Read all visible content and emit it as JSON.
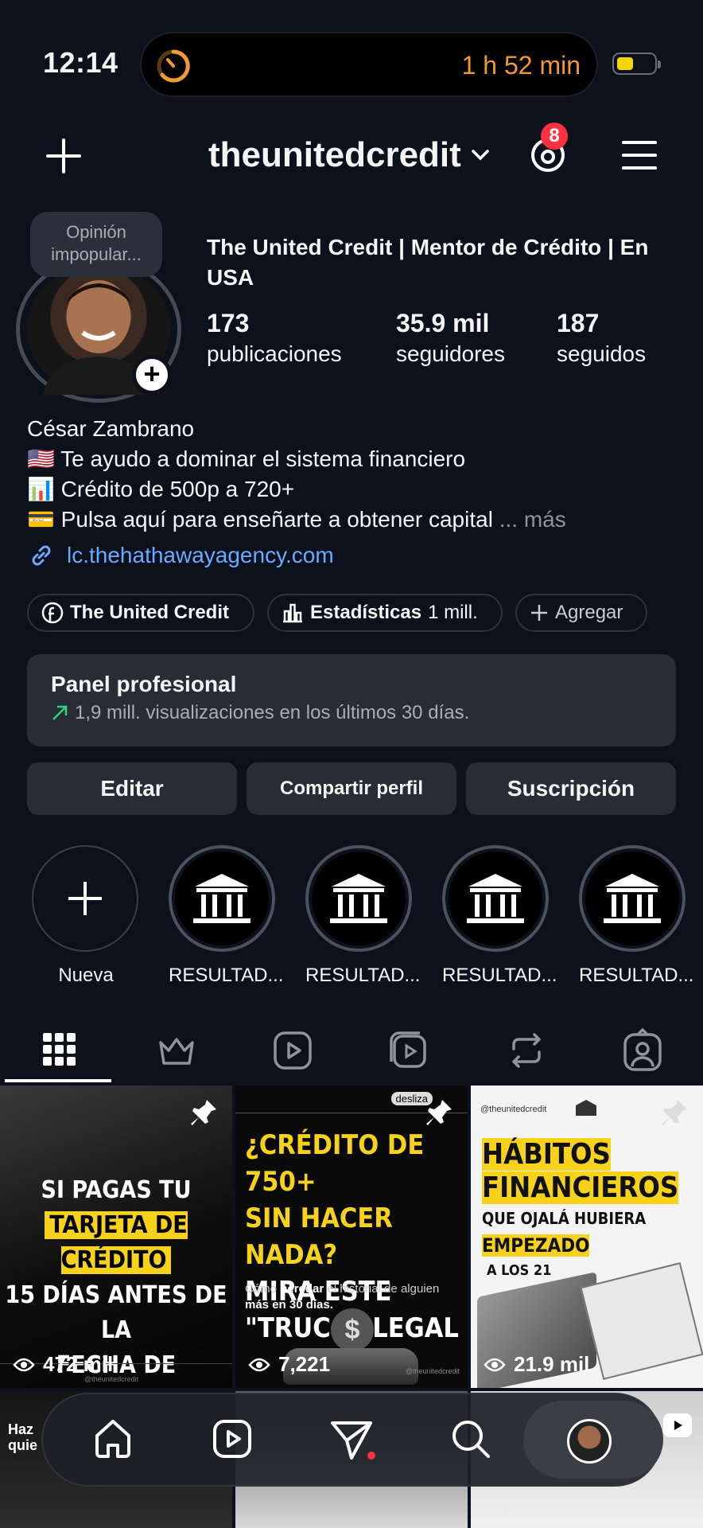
{
  "status_bar": {
    "time": "12:14",
    "timer": "1 h 52 min",
    "battery_color": "#f5d40b"
  },
  "header": {
    "username": "theunitedcredit",
    "notification_count": "8"
  },
  "profile": {
    "note": "Opinión impopular...",
    "display_name": "The United Credit | Mentor de Crédito | En USA",
    "stats": [
      {
        "value": "173",
        "label": "publicaciones"
      },
      {
        "value": "35.9 mil",
        "label": "seguidores"
      },
      {
        "value": "187",
        "label": "seguidos"
      }
    ],
    "bio": {
      "name": "César Zambrano",
      "line1": "🇺🇸 Te ayudo a dominar el sistema financiero",
      "line2": "📊 Crédito de 500p a 720+",
      "line3": "💳 Pulsa aquí para enseñarte a obtener capital",
      "more": "... más"
    },
    "link": "lc.thehathawayagency.com"
  },
  "chips": {
    "facebook": "The United Credit",
    "stats_label": "Estadísticas",
    "stats_value": "1 mill.",
    "add": "Agregar"
  },
  "panel": {
    "title": "Panel profesional",
    "subtitle": "1,9 mill. visualizaciones en los últimos 30 días."
  },
  "actions": {
    "edit": "Editar",
    "share": "Compartir perfil",
    "subscription": "Suscripción"
  },
  "highlights": [
    {
      "label": "Nueva"
    },
    {
      "label": "RESULTAD..."
    },
    {
      "label": "RESULTAD..."
    },
    {
      "label": "RESULTAD..."
    },
    {
      "label": "RESULTAD..."
    }
  ],
  "posts": [
    {
      "l1": "SI PAGAS TU",
      "l2": "TARJETA DE CRÉDITO",
      "l3": "15 DÍAS ANTES DE LA",
      "l4": "FECHA DE VENCIMIENTO",
      "views": "472 mil",
      "handle": "@theunitedcredit"
    },
    {
      "tag": "desliza",
      "l1": "¿CRÉDITO DE 750+",
      "l2": "SIN HACER NADA?",
      "l3": "MIRA ESTE",
      "l4": "\"TRUCO\" LEGAL",
      "caption_a": "Cómo",
      "caption_b": "heredar",
      "caption_c": "el historial de alguien",
      "caption_d": "más en 30 días.",
      "views": "7,221",
      "handle": "@theunitedcredit"
    },
    {
      "handle": "@theunitedcredit",
      "l1": "HÁBITOS",
      "l2": "FINANCIEROS",
      "l3": "QUE OJALÁ HUBIERA",
      "l4": "EMPEZADO",
      "l5": "A LOS 21",
      "views": "21.9 mil"
    }
  ],
  "row2": {
    "left_text_a": "Haz",
    "left_text_b": "quie"
  }
}
